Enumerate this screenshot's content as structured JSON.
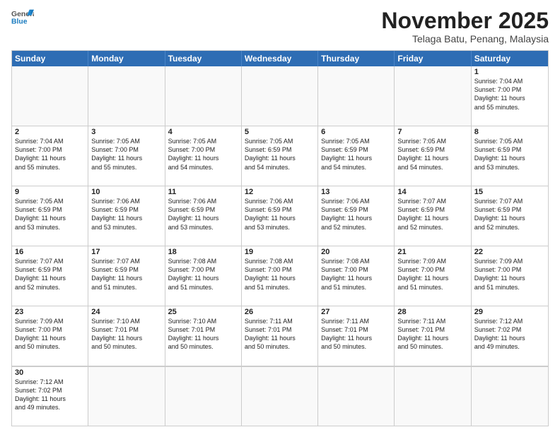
{
  "header": {
    "logo_general": "General",
    "logo_blue": "Blue",
    "month_title": "November 2025",
    "location": "Telaga Batu, Penang, Malaysia"
  },
  "weekdays": [
    "Sunday",
    "Monday",
    "Tuesday",
    "Wednesday",
    "Thursday",
    "Friday",
    "Saturday"
  ],
  "rows": [
    [
      {
        "day": "",
        "text": ""
      },
      {
        "day": "",
        "text": ""
      },
      {
        "day": "",
        "text": ""
      },
      {
        "day": "",
        "text": ""
      },
      {
        "day": "",
        "text": ""
      },
      {
        "day": "",
        "text": ""
      },
      {
        "day": "1",
        "text": "Sunrise: 7:04 AM\nSunset: 7:00 PM\nDaylight: 11 hours\nand 55 minutes."
      }
    ],
    [
      {
        "day": "2",
        "text": "Sunrise: 7:04 AM\nSunset: 7:00 PM\nDaylight: 11 hours\nand 55 minutes."
      },
      {
        "day": "3",
        "text": "Sunrise: 7:05 AM\nSunset: 7:00 PM\nDaylight: 11 hours\nand 55 minutes."
      },
      {
        "day": "4",
        "text": "Sunrise: 7:05 AM\nSunset: 7:00 PM\nDaylight: 11 hours\nand 54 minutes."
      },
      {
        "day": "5",
        "text": "Sunrise: 7:05 AM\nSunset: 6:59 PM\nDaylight: 11 hours\nand 54 minutes."
      },
      {
        "day": "6",
        "text": "Sunrise: 7:05 AM\nSunset: 6:59 PM\nDaylight: 11 hours\nand 54 minutes."
      },
      {
        "day": "7",
        "text": "Sunrise: 7:05 AM\nSunset: 6:59 PM\nDaylight: 11 hours\nand 54 minutes."
      },
      {
        "day": "8",
        "text": "Sunrise: 7:05 AM\nSunset: 6:59 PM\nDaylight: 11 hours\nand 53 minutes."
      }
    ],
    [
      {
        "day": "9",
        "text": "Sunrise: 7:05 AM\nSunset: 6:59 PM\nDaylight: 11 hours\nand 53 minutes."
      },
      {
        "day": "10",
        "text": "Sunrise: 7:06 AM\nSunset: 6:59 PM\nDaylight: 11 hours\nand 53 minutes."
      },
      {
        "day": "11",
        "text": "Sunrise: 7:06 AM\nSunset: 6:59 PM\nDaylight: 11 hours\nand 53 minutes."
      },
      {
        "day": "12",
        "text": "Sunrise: 7:06 AM\nSunset: 6:59 PM\nDaylight: 11 hours\nand 53 minutes."
      },
      {
        "day": "13",
        "text": "Sunrise: 7:06 AM\nSunset: 6:59 PM\nDaylight: 11 hours\nand 52 minutes."
      },
      {
        "day": "14",
        "text": "Sunrise: 7:07 AM\nSunset: 6:59 PM\nDaylight: 11 hours\nand 52 minutes."
      },
      {
        "day": "15",
        "text": "Sunrise: 7:07 AM\nSunset: 6:59 PM\nDaylight: 11 hours\nand 52 minutes."
      }
    ],
    [
      {
        "day": "16",
        "text": "Sunrise: 7:07 AM\nSunset: 6:59 PM\nDaylight: 11 hours\nand 52 minutes."
      },
      {
        "day": "17",
        "text": "Sunrise: 7:07 AM\nSunset: 6:59 PM\nDaylight: 11 hours\nand 51 minutes."
      },
      {
        "day": "18",
        "text": "Sunrise: 7:08 AM\nSunset: 7:00 PM\nDaylight: 11 hours\nand 51 minutes."
      },
      {
        "day": "19",
        "text": "Sunrise: 7:08 AM\nSunset: 7:00 PM\nDaylight: 11 hours\nand 51 minutes."
      },
      {
        "day": "20",
        "text": "Sunrise: 7:08 AM\nSunset: 7:00 PM\nDaylight: 11 hours\nand 51 minutes."
      },
      {
        "day": "21",
        "text": "Sunrise: 7:09 AM\nSunset: 7:00 PM\nDaylight: 11 hours\nand 51 minutes."
      },
      {
        "day": "22",
        "text": "Sunrise: 7:09 AM\nSunset: 7:00 PM\nDaylight: 11 hours\nand 51 minutes."
      }
    ],
    [
      {
        "day": "23",
        "text": "Sunrise: 7:09 AM\nSunset: 7:00 PM\nDaylight: 11 hours\nand 50 minutes."
      },
      {
        "day": "24",
        "text": "Sunrise: 7:10 AM\nSunset: 7:01 PM\nDaylight: 11 hours\nand 50 minutes."
      },
      {
        "day": "25",
        "text": "Sunrise: 7:10 AM\nSunset: 7:01 PM\nDaylight: 11 hours\nand 50 minutes."
      },
      {
        "day": "26",
        "text": "Sunrise: 7:11 AM\nSunset: 7:01 PM\nDaylight: 11 hours\nand 50 minutes."
      },
      {
        "day": "27",
        "text": "Sunrise: 7:11 AM\nSunset: 7:01 PM\nDaylight: 11 hours\nand 50 minutes."
      },
      {
        "day": "28",
        "text": "Sunrise: 7:11 AM\nSunset: 7:01 PM\nDaylight: 11 hours\nand 50 minutes."
      },
      {
        "day": "29",
        "text": "Sunrise: 7:12 AM\nSunset: 7:02 PM\nDaylight: 11 hours\nand 49 minutes."
      }
    ],
    [
      {
        "day": "30",
        "text": "Sunrise: 7:12 AM\nSunset: 7:02 PM\nDaylight: 11 hours\nand 49 minutes."
      },
      {
        "day": "",
        "text": ""
      },
      {
        "day": "",
        "text": ""
      },
      {
        "day": "",
        "text": ""
      },
      {
        "day": "",
        "text": ""
      },
      {
        "day": "",
        "text": ""
      },
      {
        "day": "",
        "text": ""
      }
    ]
  ]
}
